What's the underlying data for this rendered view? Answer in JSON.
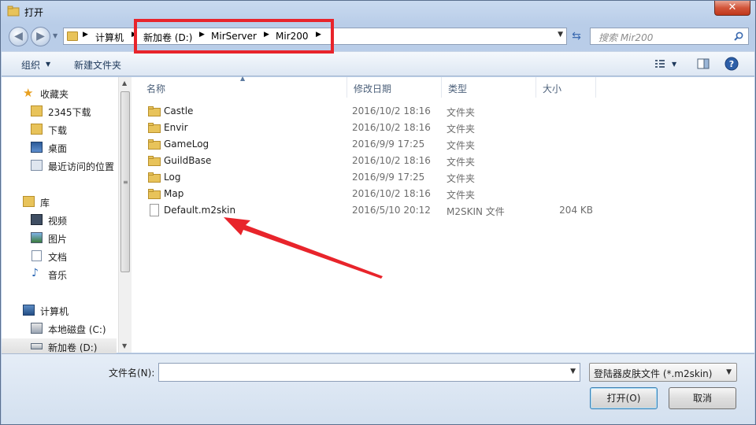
{
  "window": {
    "title": "打开",
    "close": "✕"
  },
  "nav": {
    "breadcrumbs": [
      "计算机",
      "新加卷 (D:)",
      "MirServer",
      "Mir200"
    ],
    "search_placeholder": "搜索 Mir200"
  },
  "toolbar": {
    "organize": "组织",
    "new_folder": "新建文件夹"
  },
  "sidebar": {
    "favorites": {
      "label": "收藏夹",
      "items": [
        "2345下载",
        "下载",
        "桌面",
        "最近访问的位置"
      ]
    },
    "libraries": {
      "label": "库",
      "items": [
        "视频",
        "图片",
        "文档",
        "音乐"
      ]
    },
    "computer": {
      "label": "计算机",
      "items": [
        "本地磁盘 (C:)",
        "新加卷 (D:)"
      ]
    }
  },
  "columns": {
    "name": "名称",
    "date": "修改日期",
    "type": "类型",
    "size": "大小"
  },
  "files": [
    {
      "name": "Castle",
      "date": "2016/10/2 18:16",
      "type": "文件夹",
      "size": "",
      "kind": "folder"
    },
    {
      "name": "Envir",
      "date": "2016/10/2 18:16",
      "type": "文件夹",
      "size": "",
      "kind": "folder"
    },
    {
      "name": "GameLog",
      "date": "2016/9/9 17:25",
      "type": "文件夹",
      "size": "",
      "kind": "folder"
    },
    {
      "name": "GuildBase",
      "date": "2016/10/2 18:16",
      "type": "文件夹",
      "size": "",
      "kind": "folder"
    },
    {
      "name": "Log",
      "date": "2016/9/9 17:25",
      "type": "文件夹",
      "size": "",
      "kind": "folder"
    },
    {
      "name": "Map",
      "date": "2016/10/2 18:16",
      "type": "文件夹",
      "size": "",
      "kind": "folder"
    },
    {
      "name": "Default.m2skin",
      "date": "2016/5/10 20:12",
      "type": "M2SKIN 文件",
      "size": "204 KB",
      "kind": "file"
    }
  ],
  "bottom": {
    "filename_label": "文件名(N):",
    "filename_value": "",
    "filter": "登陆器皮肤文件 (*.m2skin)",
    "open_button": "打开(O)",
    "cancel_button": "取消"
  },
  "colors": {
    "annotation": "#e8242b",
    "folder": "#e8c35a"
  }
}
